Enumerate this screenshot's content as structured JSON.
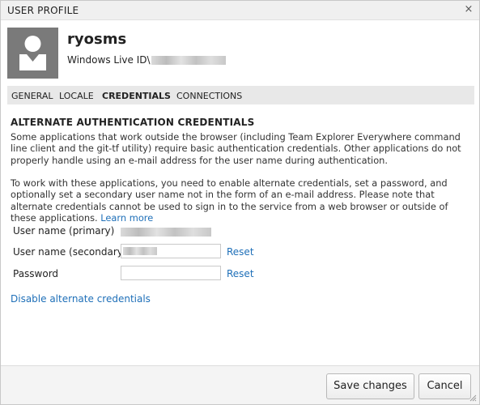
{
  "dialog": {
    "title": "USER PROFILE",
    "close_glyph": "×"
  },
  "profile": {
    "display_name": "ryosms",
    "account_prefix": "Windows Live ID\\"
  },
  "tabs": [
    {
      "label": "GENERAL",
      "active": false
    },
    {
      "label": "LOCALE",
      "active": false
    },
    {
      "label": "CREDENTIALS",
      "active": true
    },
    {
      "label": "CONNECTIONS",
      "active": false
    }
  ],
  "credentials": {
    "heading": "ALTERNATE AUTHENTICATION CREDENTIALS",
    "intro": "Some applications that work outside the browser (including Team Explorer Everywhere command line client and the git-tf utility) require basic authentication credentials. Other applications do not properly handle using an e-mail address for the user name during authentication.",
    "instructions": "To work with these applications, you need to enable alternate credentials, set a password, and optionally set a secondary user name not in the form of an e-mail address. Please note that alternate credentials cannot be used to sign in to the service from a web browser or outside of these applications.",
    "learn_more": "Learn more",
    "fields": {
      "primary_label": "User name (primary)",
      "secondary_label": "User name (secondary)",
      "password_label": "Password",
      "reset_label": "Reset"
    },
    "disable_link": "Disable alternate credentials"
  },
  "footer": {
    "save_label": "Save changes",
    "cancel_label": "Cancel"
  },
  "colors": {
    "link": "#1e6fb8",
    "avatar_bg": "#7a7a7a",
    "tab_bar": "#e8e8e8"
  },
  "icons": {
    "avatar": "user-silhouette-icon",
    "close": "close-icon",
    "grip": "resize-grip-icon"
  }
}
